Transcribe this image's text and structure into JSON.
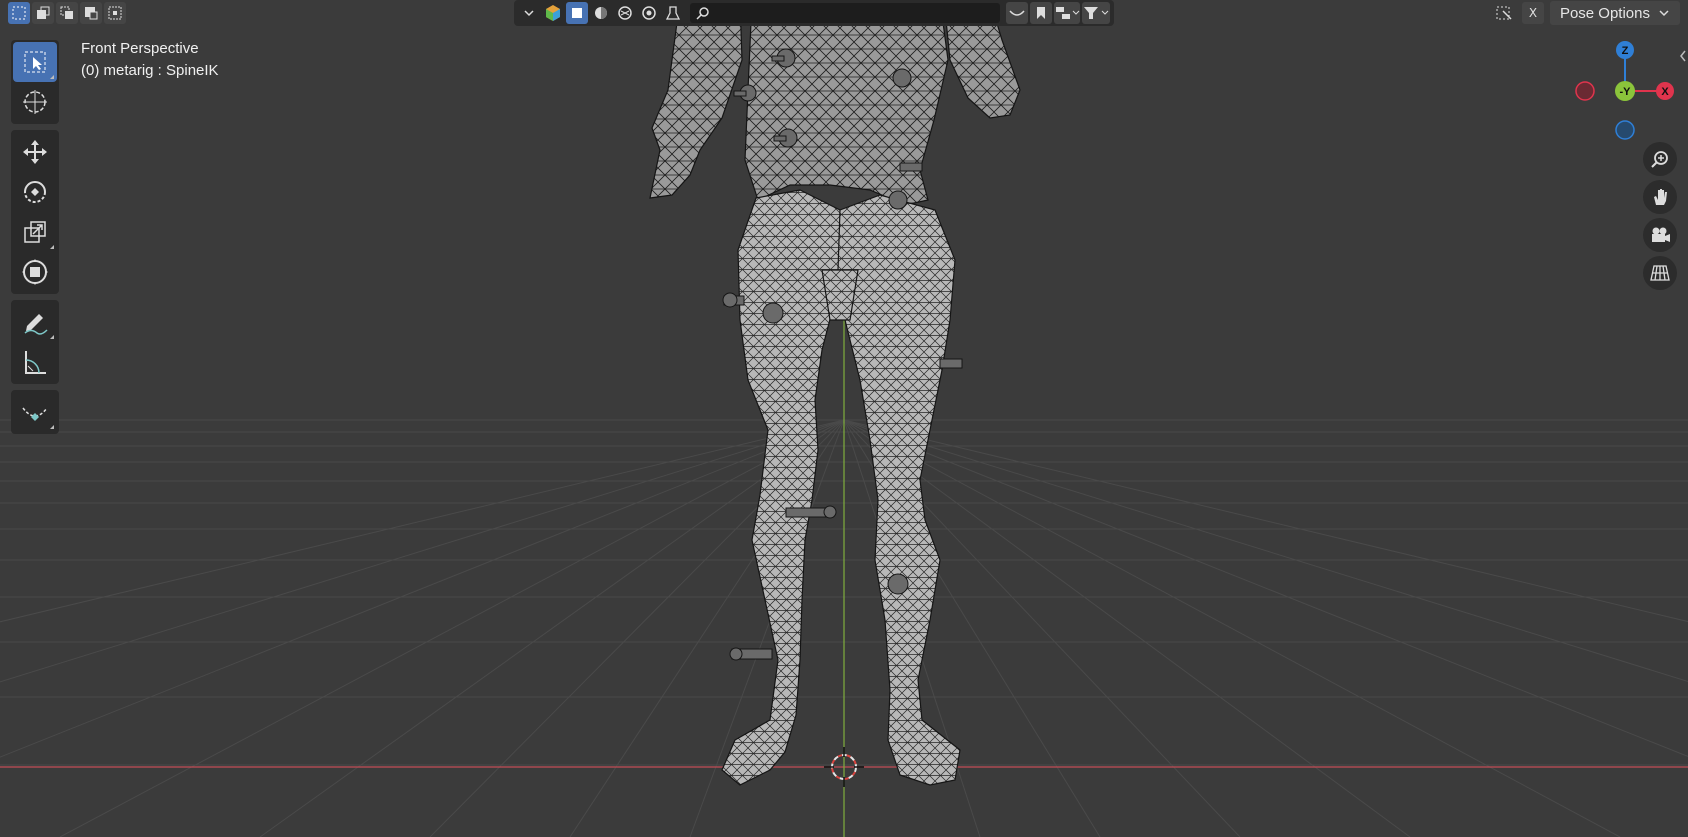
{
  "viewport": {
    "view_name": "Front Perspective",
    "context_line": "(0) metarig : SpineIK"
  },
  "header": {
    "select_modes": [
      "select-box",
      "mode-new",
      "mode-extend",
      "mode-subtract",
      "mode-invert"
    ],
    "center_icons": [
      "visibility-chevron-icon",
      "gizmo-icon",
      "solid-shading-icon",
      "material-shading-icon",
      "rendered-shading-icon",
      "shading-options-icon",
      "overlays-icon"
    ],
    "search_placeholder": "",
    "xray_label": "X",
    "pose_options_label": "Pose Options"
  },
  "toolbar": {
    "tools": [
      "select-box",
      "cursor",
      "move",
      "rotate",
      "scale",
      "transform",
      "annotate",
      "measure",
      "relax"
    ]
  },
  "gizmo": {
    "z_label": "Z",
    "y_label": "-Y",
    "x_label": "X",
    "colors": {
      "x": "#e0344d",
      "y": "#8bc43b",
      "z": "#2f7fd6"
    }
  },
  "colors": {
    "background": "#3b3b3b",
    "grid": "#4a4a4a",
    "x_axis": "#c24d56",
    "y_axis": "#7fae3e",
    "accent": "#4772b3"
  }
}
